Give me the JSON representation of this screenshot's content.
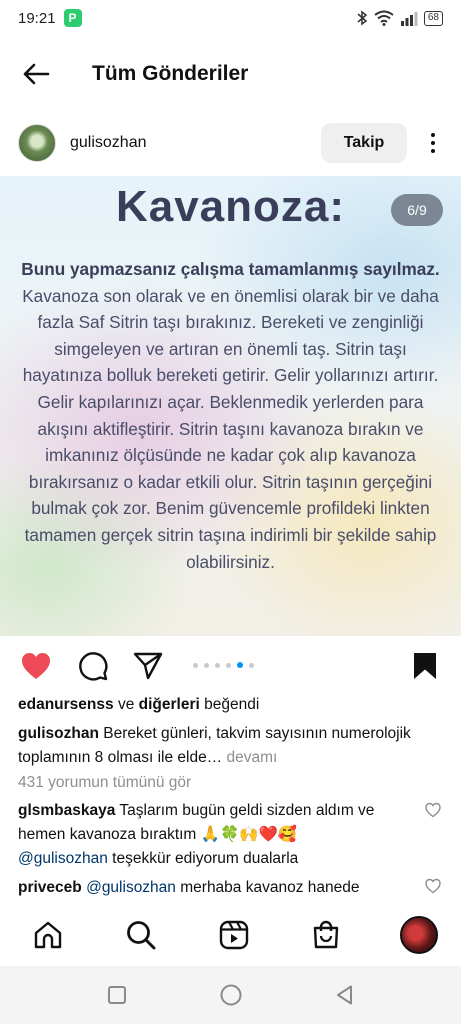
{
  "status": {
    "time": "19:21",
    "app_badge": "P",
    "battery": "68"
  },
  "header": {
    "title": "Tüm Gönderiler"
  },
  "post": {
    "username": "gulisozhan",
    "follow_label": "Takip",
    "heading": "Kavanoza:",
    "page_indicator": "6/9",
    "body_bold": "Bunu yapmazsanız çalışma tamamlanmış sayılmaz.",
    "body_text": " Kavanoza son olarak ve en önemlisi olarak bir ve daha fazla Saf Sitrin taşı bırakınız. Bereketi ve zenginliği simgeleyen ve artıran en önemli taş. Sitrin taşı hayatınıza bolluk bereketi getirir. Gelir yollarınızı artırır. Gelir kapılarınızı açar. Beklenmedik yerlerden para akışını aktifleştirir. Sitrin taşını kavanoza bırakın ve imkanınız ölçüsünde ne kadar çok alıp kavanoza bırakırsanız o kadar etkili olur. Sitrin taşının gerçeğini bulmak çok zor. Benim güvencemle profildeki linkten tamamen gerçek sitrin taşına indirimli bir şekilde sahip olabilirsiniz.",
    "carousel": {
      "total": 6,
      "active_index": 4
    }
  },
  "engagement": {
    "liked_by_user": "edanursenss",
    "liked_connector": " ve ",
    "liked_others": "diğerleri",
    "liked_suffix": " beğendi",
    "caption_user": "gulisozhan",
    "caption_text": " Bereket günleri, takvim sayısının numerolojik toplamının 8 olması ile elde…",
    "caption_more": " devamı",
    "view_comments": "431 yorumun tümünü gör"
  },
  "comments": [
    {
      "user": "glsmbaskaya",
      "text": " Taşlarım bugün geldi sizden aldım ve hemen kavanoza bıraktım 🙏🍀🙌❤️🥰",
      "mention": "@gulisozhan",
      "text2": "  teşekkür ediyorum dualarla"
    },
    {
      "user": "priveceb",
      "mention": "@gulisozhan",
      "text": "  merhaba kavanoz hanede"
    }
  ],
  "icons": {
    "like": "heart-filled-red",
    "comment": "speech-bubble",
    "share": "paper-plane",
    "save": "bookmark-filled",
    "nav": [
      "home",
      "search",
      "reels",
      "shop",
      "profile-avatar"
    ],
    "system": [
      "recents-square",
      "home-circle",
      "back-triangle"
    ]
  },
  "colors": {
    "like_red": "#ed4956",
    "mention_blue": "#00376b",
    "carousel_active": "#0095f6",
    "heading": "#3b3e5a"
  }
}
